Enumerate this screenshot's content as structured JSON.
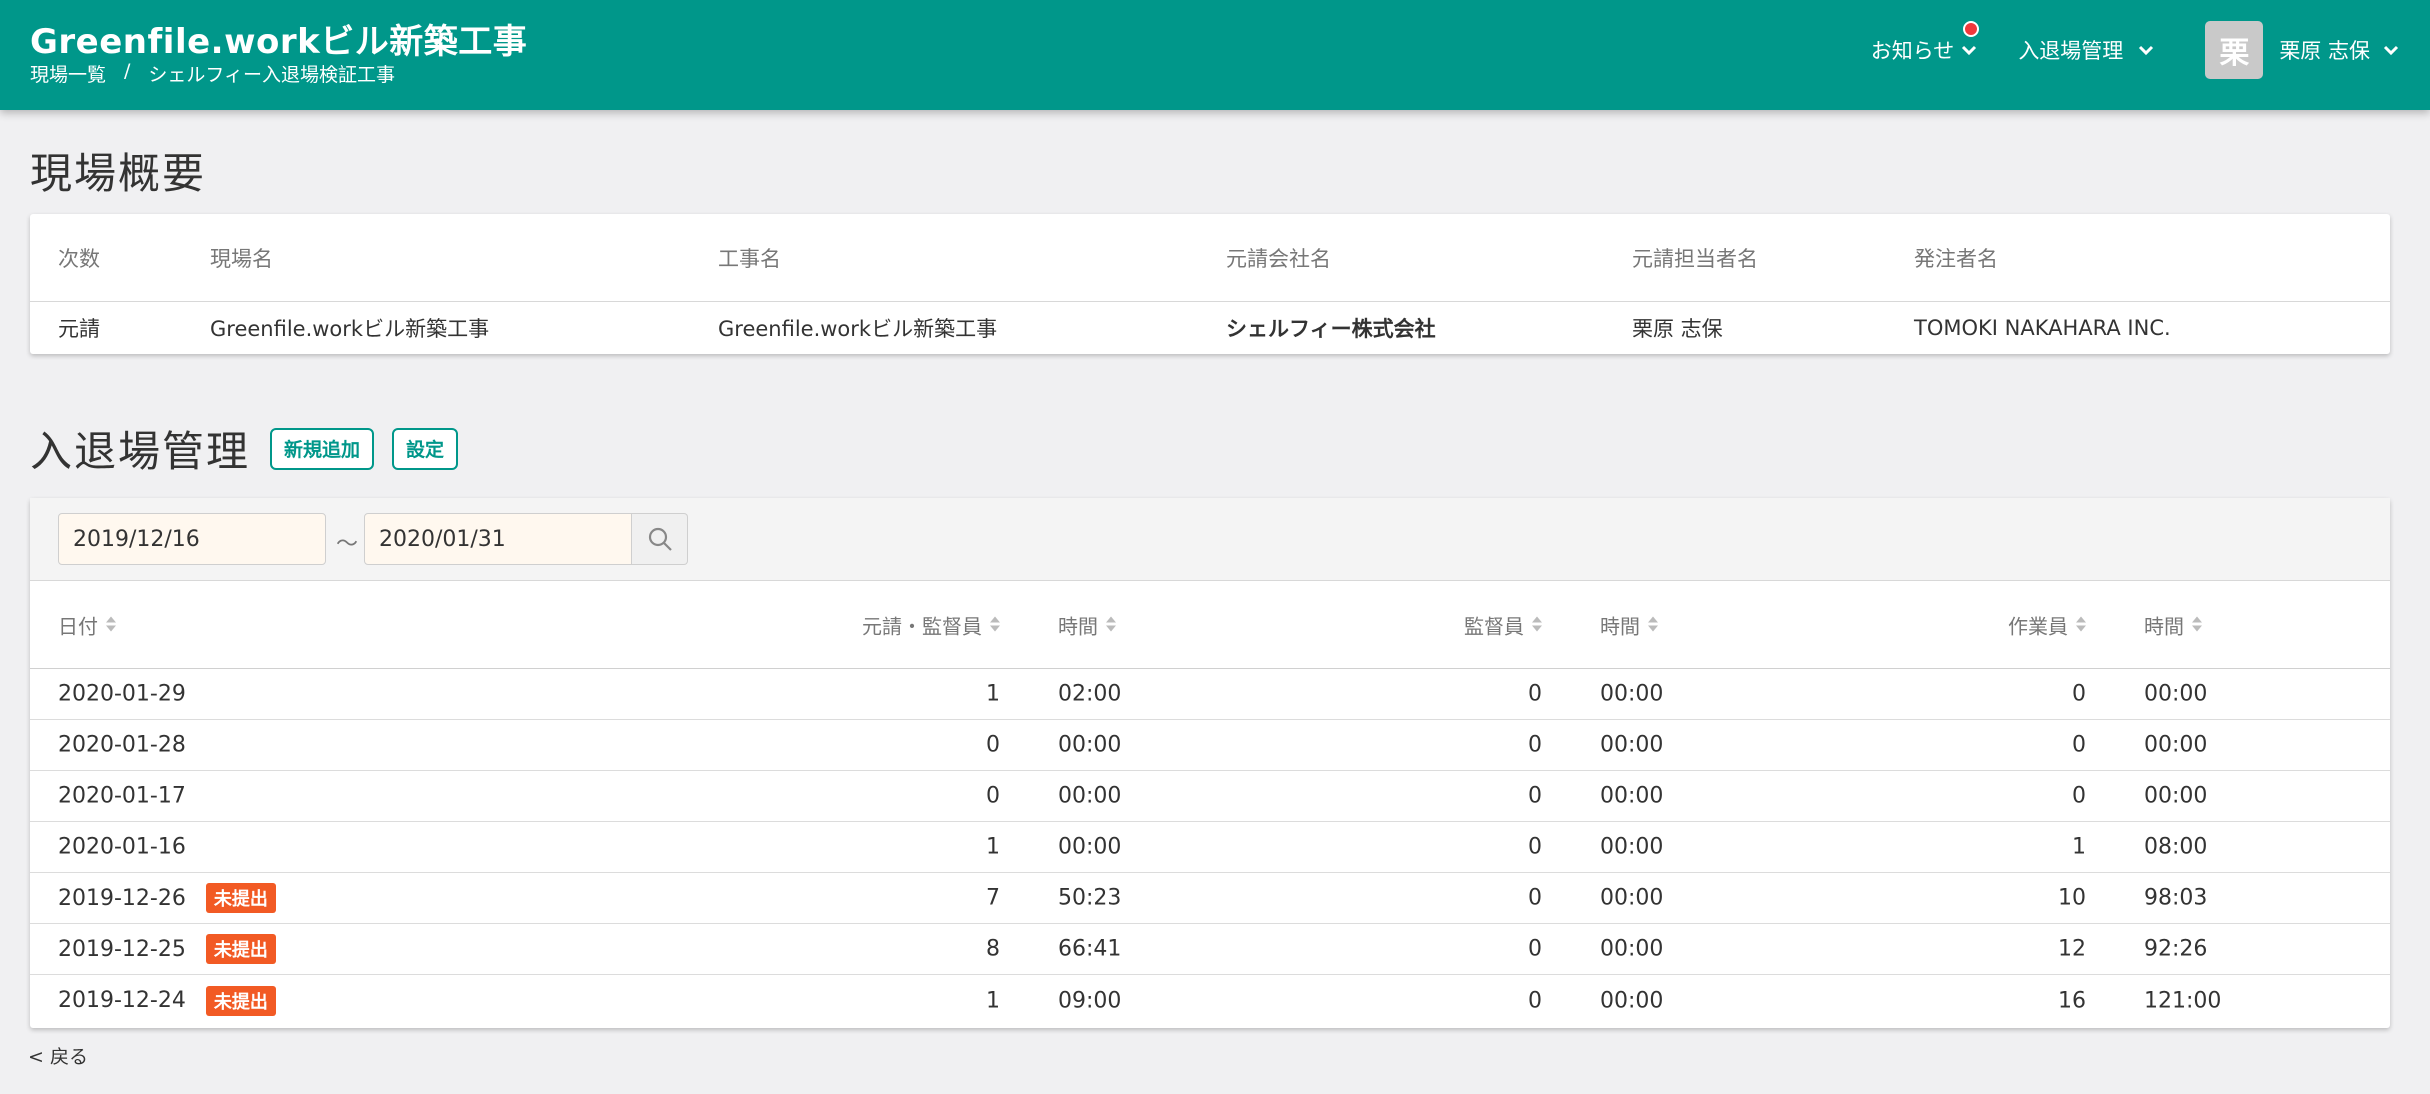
{
  "header": {
    "site_title": "Greenfile.workビル新築工事",
    "breadcrumb": [
      "現場一覧",
      "/",
      "シェルフィー入退場検証工事"
    ],
    "notice_label": "お知らせ",
    "entry_nav_label": "入退場管理",
    "avatar_char": "栗",
    "user_name": "栗原 志保"
  },
  "overview": {
    "title": "現場概要",
    "columns": [
      "次数",
      "現場名",
      "工事名",
      "元請会社名",
      "元請担当者名",
      "発注者名"
    ],
    "row": [
      "元請",
      "Greenfile.workビル新築工事",
      "Greenfile.workビル新築工事",
      "シェルフィー株式会社",
      "栗原 志保",
      "TOMOKI NAKAHARA INC."
    ]
  },
  "entry": {
    "title": "入退場管理",
    "add_button": "新規追加",
    "settings_button": "設定",
    "date_from": "2019/12/16",
    "tilde": "〜",
    "date_to": "2020/01/31",
    "columns": [
      "日付",
      "元請・監督員",
      "時間",
      "監督員",
      "時間",
      "作業員",
      "時間"
    ],
    "rows": [
      {
        "date": "2020-01-29",
        "badge": "",
        "a": "1",
        "at": "02:00",
        "b": "0",
        "bt": "00:00",
        "c": "0",
        "ct": "00:00"
      },
      {
        "date": "2020-01-28",
        "badge": "",
        "a": "0",
        "at": "00:00",
        "b": "0",
        "bt": "00:00",
        "c": "0",
        "ct": "00:00"
      },
      {
        "date": "2020-01-17",
        "badge": "",
        "a": "0",
        "at": "00:00",
        "b": "0",
        "bt": "00:00",
        "c": "0",
        "ct": "00:00"
      },
      {
        "date": "2020-01-16",
        "badge": "",
        "a": "1",
        "at": "00:00",
        "b": "0",
        "bt": "00:00",
        "c": "1",
        "ct": "08:00"
      },
      {
        "date": "2019-12-26",
        "badge": "未提出",
        "a": "7",
        "at": "50:23",
        "b": "0",
        "bt": "00:00",
        "c": "10",
        "ct": "98:03"
      },
      {
        "date": "2019-12-25",
        "badge": "未提出",
        "a": "8",
        "at": "66:41",
        "b": "0",
        "bt": "00:00",
        "c": "12",
        "ct": "92:26"
      },
      {
        "date": "2019-12-24",
        "badge": "未提出",
        "a": "1",
        "at": "09:00",
        "b": "0",
        "bt": "00:00",
        "c": "16",
        "ct": "121:00"
      }
    ]
  },
  "footer": {
    "back_label": "< 戻る"
  },
  "colors": {
    "primary": "#00978a",
    "badge": "#f25a24",
    "notice_dot": "#f0383b"
  }
}
